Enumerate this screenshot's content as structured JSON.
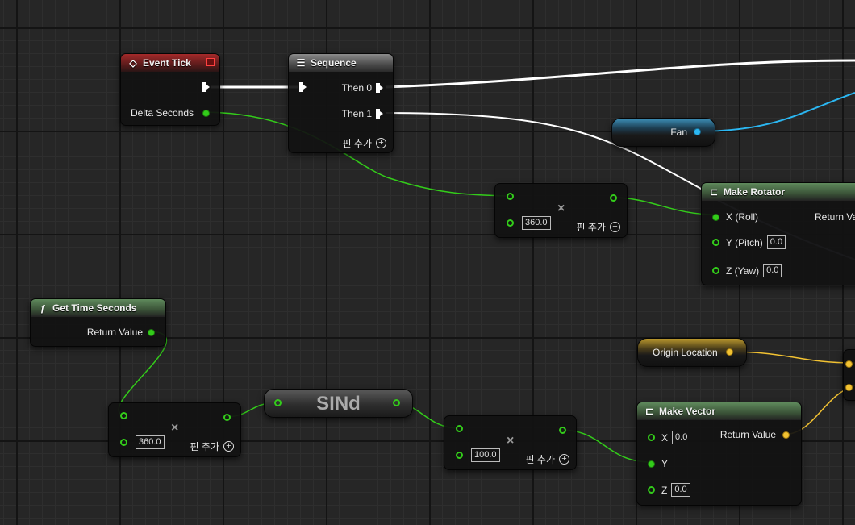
{
  "nodes": {
    "event_tick": {
      "title": "Event Tick",
      "delta_label": "Delta Seconds"
    },
    "sequence": {
      "title": "Sequence",
      "then0": "Then 0",
      "then1": "Then 1",
      "add_pin": "핀 추가"
    },
    "fan": {
      "label": "Fan"
    },
    "multiply1": {
      "value": "360.0",
      "add_pin": "핀 추가"
    },
    "make_rotator": {
      "title": "Make Rotator",
      "x_label": "X (Roll)",
      "y_label": "Y (Pitch)",
      "y_value": "0.0",
      "z_label": "Z (Yaw)",
      "z_value": "0.0",
      "return_label": "Return Va"
    },
    "get_time": {
      "title": "Get Time Seconds",
      "return_label": "Return Value"
    },
    "multiply2": {
      "value": "360.0",
      "add_pin": "핀 추가"
    },
    "sind": {
      "label": "SINd"
    },
    "multiply3": {
      "value": "100.0",
      "add_pin": "핀 추가"
    },
    "origin": {
      "label": "Origin Location"
    },
    "make_vector": {
      "title": "Make Vector",
      "x_label": "X",
      "x_value": "0.0",
      "y_label": "Y",
      "z_label": "Z",
      "z_value": "0.0",
      "return_label": "Return Value"
    }
  },
  "colors": {
    "exec": "#ffffff",
    "float": "#33cc1a",
    "vector": "#f2c232",
    "object": "#2bb7f2",
    "rotator": "#9a9ac8"
  },
  "icons": {
    "event": "diamond-event-icon",
    "sequence": "sequence-icon",
    "function": "function-f-icon",
    "make": "make-struct-icon"
  }
}
